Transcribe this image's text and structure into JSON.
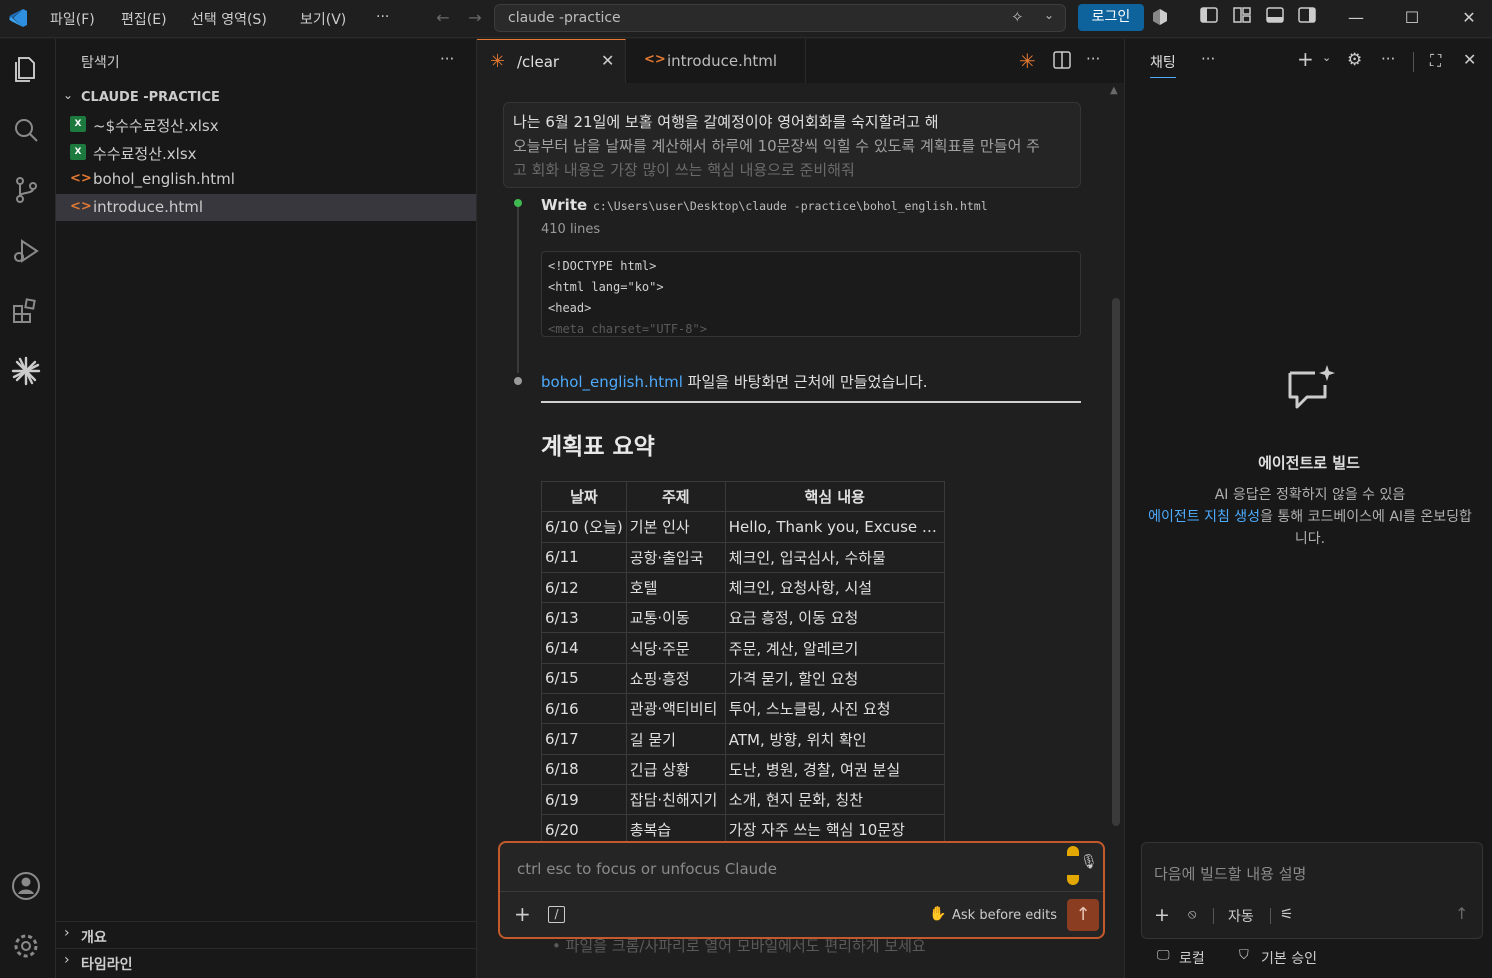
{
  "menu": [
    "파일(F)",
    "편집(E)",
    "선택 영역(S)",
    "보기(V)"
  ],
  "search": {
    "text": "claude -practice"
  },
  "login_label": "로그인",
  "sidebar": {
    "title": "탐색기",
    "project": "CLAUDE -PRACTICE",
    "files": [
      {
        "name": "~$수수료정산.xlsx",
        "type": "xlsx"
      },
      {
        "name": "수수료정산.xlsx",
        "type": "xlsx"
      },
      {
        "name": "bohol_english.html",
        "type": "html"
      },
      {
        "name": "introduce.html",
        "type": "html"
      }
    ],
    "sections": [
      "개요",
      "타임라인"
    ]
  },
  "tabs": [
    {
      "label": "/clear"
    },
    {
      "label": "introduce.html"
    }
  ],
  "conversation": {
    "user_line1": "나는 6월 21일에 보홀 여행을 갈예정이야 영어회화를 숙지할려고 해",
    "user_line2": "오늘부터 남을 날짜를 계산해서 하루에 10문장씩 익힐 수 있도록 계획표를 만들어 주",
    "user_line3": "고 회화 내용은 가장 많이 쓰는 핵심 내용으로 준비해줘",
    "write_label": "Write",
    "write_path": "c:\\Users\\user\\Desktop\\claude -practice\\bohol_english.html",
    "write_lines": "410 lines",
    "code": [
      "<!DOCTYPE html>",
      "<html lang=\"ko\">",
      "<head>",
      "  <meta charset=\"UTF-8\">"
    ],
    "msg_link": "bohol_english.html",
    "msg_rest": " 파일을 바탕화면 근처에 만들었습니다.",
    "summary_title": "계획표 요약",
    "table_headers": [
      "날짜",
      "주제",
      "핵심 내용"
    ],
    "table_rows": [
      [
        "6/10 (오늘)",
        "기본 인사",
        "Hello, Thank you, Excuse me..."
      ],
      [
        "6/11",
        "공항·출입국",
        "체크인, 입국심사, 수하물"
      ],
      [
        "6/12",
        "호텔",
        "체크인, 요청사항, 시설"
      ],
      [
        "6/13",
        "교통·이동",
        "요금 흥정, 이동 요청"
      ],
      [
        "6/14",
        "식당·주문",
        "주문, 계산, 알레르기"
      ],
      [
        "6/15",
        "쇼핑·흥정",
        "가격 묻기, 할인 요청"
      ],
      [
        "6/16",
        "관광·액티비티",
        "투어, 스노클링, 사진 요청"
      ],
      [
        "6/17",
        "길 묻기",
        "ATM, 방향, 위치 확인"
      ],
      [
        "6/18",
        "긴급 상황",
        "도난, 병원, 경찰, 여권 분실"
      ],
      [
        "6/19",
        "잡담·친해지기",
        "소개, 현지 문화, 칭찬"
      ],
      [
        "6/20",
        "총복습",
        "가장 자주 쓰는 핵심 10문장"
      ]
    ],
    "ghost_bullet": "파일을 크롬/사파리로 열어 모바일에서도 편리하게 보세요"
  },
  "input": {
    "placeholder": "ctrl esc to focus or unfocus Claude",
    "mode_label": "Ask before edits"
  },
  "chat": {
    "tab": "채팅",
    "title": "에이전트로 빌드",
    "desc_before": "AI 응답은 정확하지 않을 수 있음",
    "desc_link": "에이전트 지침 생성",
    "desc_after": "을 통해 코드베이스에 AI를 온보딩합니다.",
    "input_placeholder": "다음에 빌드할 내용 설명",
    "auto_label": "자동",
    "footer_local": "로컬",
    "footer_approval": "기본 승인"
  },
  "colors": {
    "accent": "#e37933",
    "link": "#4daafc",
    "login": "#0e639c"
  }
}
